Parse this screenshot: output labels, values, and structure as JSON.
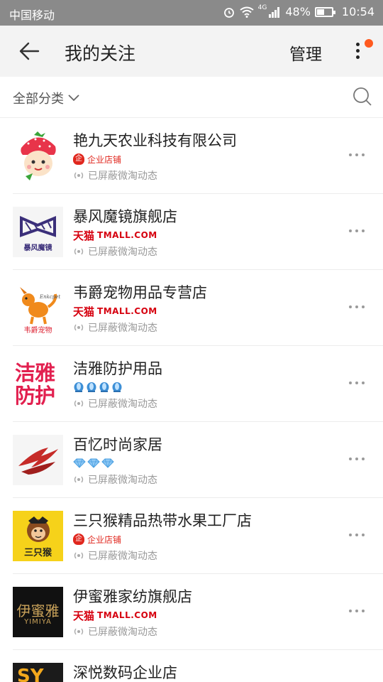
{
  "status_bar": {
    "carrier": "中国移动",
    "network": "4G",
    "battery": "48%",
    "battery_level": 0.48,
    "time": "10:54"
  },
  "header": {
    "title": "我的关注",
    "manage_label": "管理"
  },
  "filter": {
    "category_label": "全部分类"
  },
  "badges": {
    "enterprise": "企业店铺",
    "tmall_cn": "天猫",
    "tmall_en": "TMALL.COM"
  },
  "shops": [
    {
      "name": "艳九天农业科技有限公司",
      "badge_type": "enterprise",
      "status": "已屏蔽微淘动态",
      "logo_icon": "strawberry-girl-logo"
    },
    {
      "name": "暴风魔镜旗舰店",
      "badge_type": "tmall",
      "status": "已屏蔽微淘动态",
      "logo_icon": "baofeng-mojing-logo",
      "logo_text": "暴风魔镜"
    },
    {
      "name": "韦爵宠物用品专营店",
      "badge_type": "tmall",
      "status": "已屏蔽微淘动态",
      "logo_icon": "dog-logo",
      "logo_text": "韦爵宠物"
    },
    {
      "name": "洁雅防护用品",
      "badge_type": "crown",
      "badge_count": 4,
      "status": "已屏蔽微淘动态",
      "logo_icon": "jieya-logo",
      "logo_text": "洁雅防护"
    },
    {
      "name": "百忆时尚家居",
      "badge_type": "diamond",
      "badge_count": 3,
      "status": "已屏蔽微淘动态",
      "logo_icon": "baiyi-logo"
    },
    {
      "name": "三只猴精品热带水果工厂店",
      "badge_type": "enterprise",
      "status": "已屏蔽微淘动态",
      "logo_icon": "monkey-logo",
      "logo_text": "三只猴"
    },
    {
      "name": "伊蜜雅家纺旗舰店",
      "badge_type": "tmall",
      "status": "已屏蔽微淘动态",
      "logo_icon": "yimiya-logo",
      "logo_text": "伊蜜雅",
      "logo_subtext": "YIMIYA"
    },
    {
      "name": "深悦数码企业店",
      "logo_icon": "sy-logo",
      "logo_text": "SY"
    }
  ],
  "colors": {
    "status_bar": "#8a8a8a",
    "header_bg": "#f3f3f3",
    "notification_dot": "#ff5a1f",
    "tmall_red": "#d6000f",
    "enterprise_red": "#e0271e",
    "meta_gray": "#9a9a9a"
  }
}
